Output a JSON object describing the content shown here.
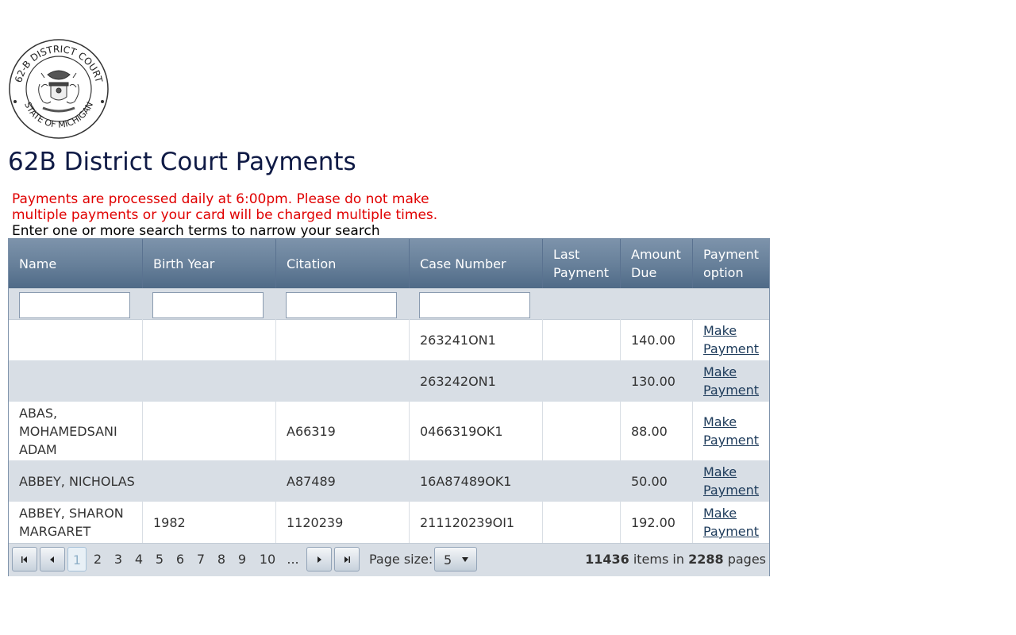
{
  "seal": {
    "top_text": "62-B DISTRICT COURT",
    "bottom_text": "STATE OF MICHIGAN"
  },
  "page_title": "62B District Court Payments",
  "notice": {
    "line1": "Payments are processed daily at 6:00pm. Please do not make",
    "line2": "multiple payments or your card will be charged multiple times.",
    "color": "#e00000"
  },
  "instructions": "Enter one or more search terms to narrow your search",
  "grid": {
    "columns": [
      {
        "label": "Name"
      },
      {
        "label": "Birth Year"
      },
      {
        "label": "Citation"
      },
      {
        "label": "Case Number"
      },
      {
        "label": "Last Payment"
      },
      {
        "label": "Amount Due"
      },
      {
        "label": "Payment option"
      }
    ],
    "filters": {
      "name": "",
      "birth_year": "",
      "citation": "",
      "case_number": ""
    },
    "rows": [
      {
        "name": "",
        "birth_year": "",
        "citation": "",
        "case_number": "263241ON1",
        "last_payment": "",
        "amount_due": "140.00",
        "action": "Make Payment"
      },
      {
        "name": "",
        "birth_year": "",
        "citation": "",
        "case_number": "263242ON1",
        "last_payment": "",
        "amount_due": "130.00",
        "action": "Make Payment"
      },
      {
        "name": "ABAS, MOHAMEDSANI ADAM",
        "birth_year": "",
        "citation": "A66319",
        "case_number": "0466319OK1",
        "last_payment": "",
        "amount_due": "88.00",
        "action": "Make Payment"
      },
      {
        "name": "ABBEY, NICHOLAS",
        "birth_year": "",
        "citation": "A87489",
        "case_number": "16A87489OK1",
        "last_payment": "",
        "amount_due": "50.00",
        "action": "Make Payment"
      },
      {
        "name": "ABBEY, SHARON MARGARET",
        "birth_year": "1982",
        "citation": "1120239",
        "case_number": "211120239OI1",
        "last_payment": "",
        "amount_due": "192.00",
        "action": "Make Payment"
      }
    ],
    "header_colors": {
      "top": "#7d93ab",
      "bottom": "#4f6a87"
    },
    "alt_row_color": "#d8dee5"
  },
  "pager": {
    "pages": [
      "1",
      "2",
      "3",
      "4",
      "5",
      "6",
      "7",
      "8",
      "9",
      "10",
      "..."
    ],
    "current_page": "1",
    "page_size_label": "Page size:",
    "page_size": "5",
    "total_items": "11436",
    "items_in_text": "items in",
    "total_pages": "2288",
    "pages_text": "pages",
    "icons": [
      "first-page-icon",
      "previous-page-icon",
      "next-page-icon",
      "last-page-icon"
    ]
  }
}
